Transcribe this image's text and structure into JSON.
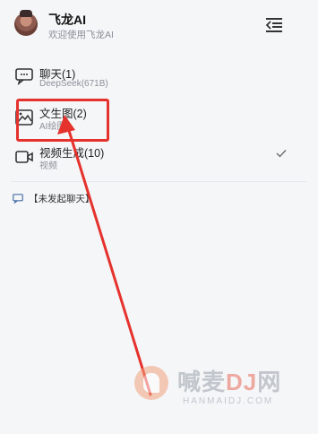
{
  "header": {
    "title": "飞龙AI",
    "subtitle": "欢迎使用飞龙AI"
  },
  "menu": [
    {
      "id": "chat",
      "title": "聊天(1)",
      "subtitle": "DeepSeek(671B)",
      "icon": "chat-bubble-icon",
      "selected": false
    },
    {
      "id": "image",
      "title": "文生图(2)",
      "subtitle": "AI绘图",
      "icon": "image-icon",
      "selected": false
    },
    {
      "id": "video",
      "title": "视频生成(10)",
      "subtitle": "视频",
      "icon": "video-camera-icon",
      "selected": true
    }
  ],
  "conversation": {
    "label": "【未发起聊天】",
    "icon": "message-icon"
  },
  "annotation": {
    "color": "#e5322d"
  },
  "watermark": {
    "brand_a": "喊麦",
    "brand_b": "DJ",
    "brand_c": "网",
    "domain": "HANMAIDJ.COM"
  }
}
